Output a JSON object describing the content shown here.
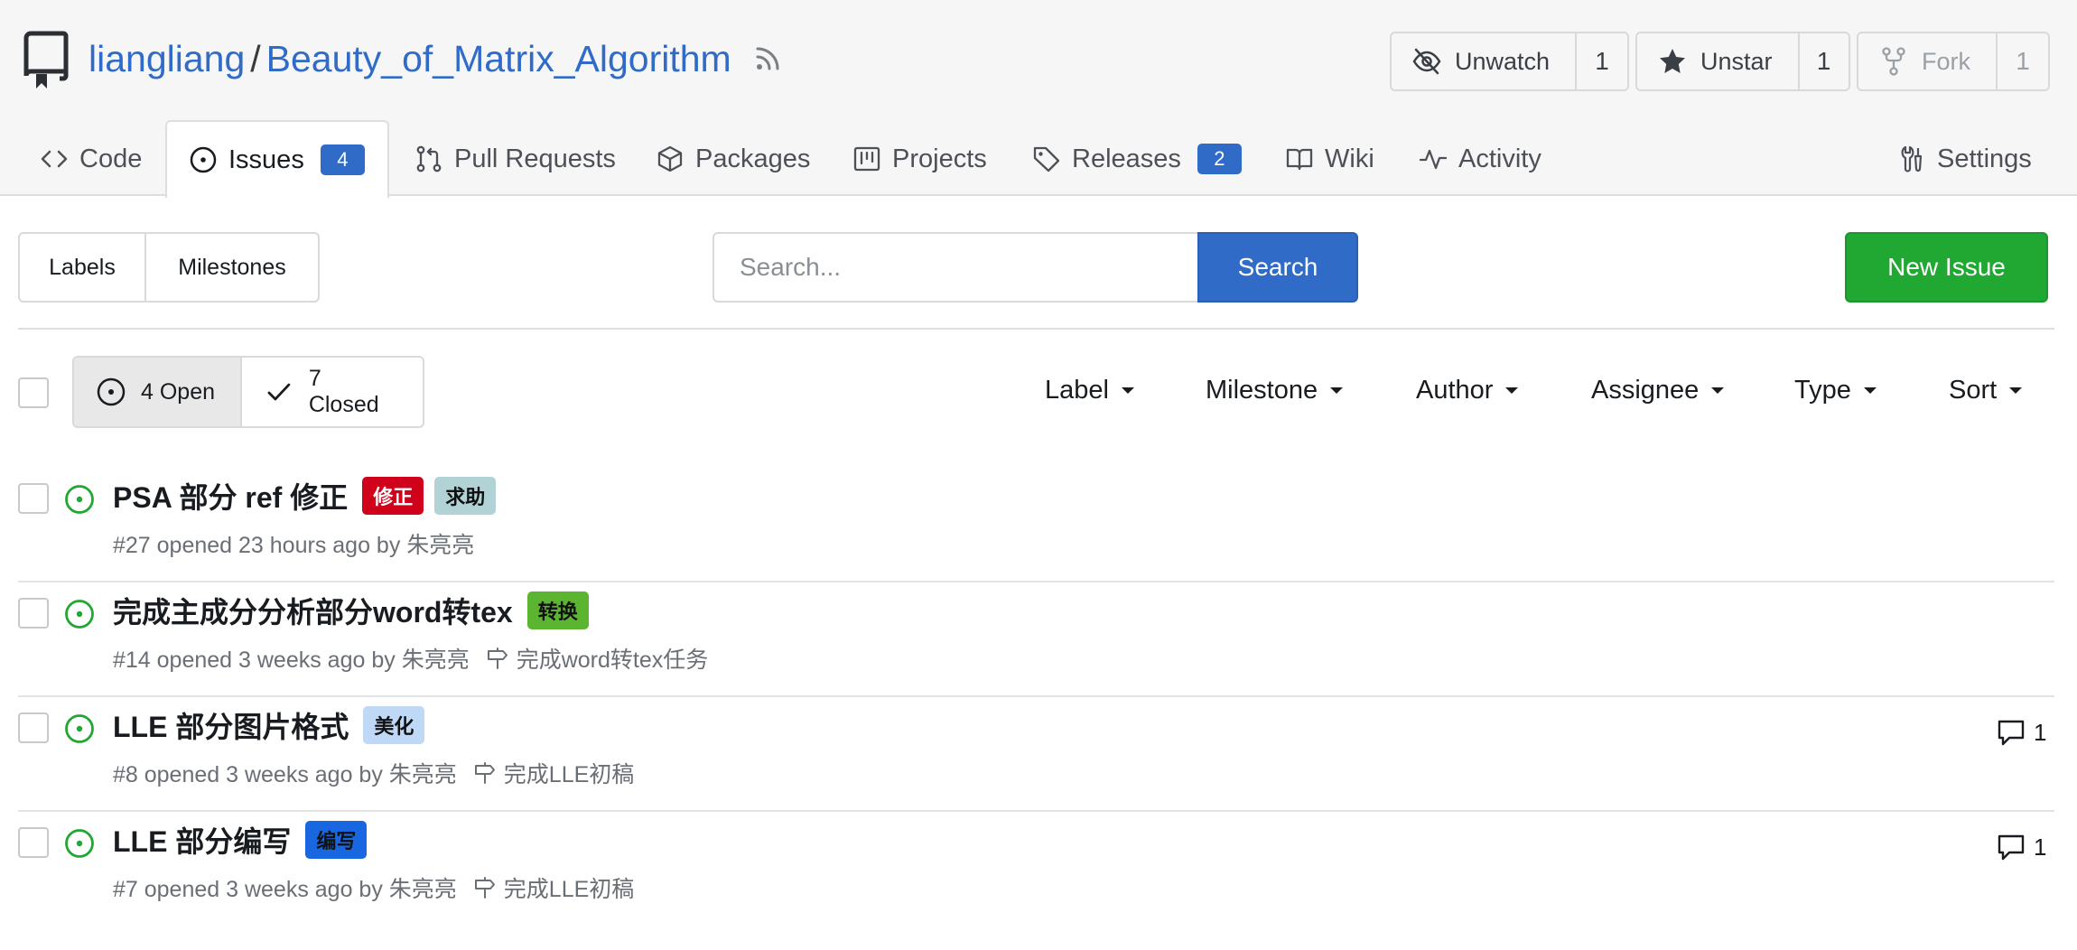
{
  "repo": {
    "owner": "liangliang",
    "separator": "/",
    "name": "Beauty_of_Matrix_Algorithm"
  },
  "actions": {
    "watch": {
      "label": "Unwatch",
      "count": "1"
    },
    "star": {
      "label": "Unstar",
      "count": "1"
    },
    "fork": {
      "label": "Fork",
      "count": "1"
    }
  },
  "tabs": {
    "code": "Code",
    "issues": {
      "label": "Issues",
      "count": "4"
    },
    "pulls": "Pull Requests",
    "packages": "Packages",
    "projects": "Projects",
    "releases": {
      "label": "Releases",
      "count": "2"
    },
    "wiki": "Wiki",
    "activity": "Activity",
    "settings": "Settings"
  },
  "toolbar": {
    "labels": "Labels",
    "milestones": "Milestones",
    "search_placeholder": "Search...",
    "search_button": "Search",
    "new_issue": "New Issue"
  },
  "state_filter": {
    "open": "4 Open",
    "closed": "7 Closed"
  },
  "filters": {
    "label": "Label",
    "milestone": "Milestone",
    "author": "Author",
    "assignee": "Assignee",
    "type": "Type",
    "sort": "Sort"
  },
  "colors": {
    "link": "#2f6bc7",
    "primary": "#2f6bc7",
    "success": "#21a833",
    "open_state": "#21a833"
  },
  "issues": [
    {
      "title": "PSA 部分 ref 修正",
      "labels": [
        {
          "text": "修正",
          "bg": "#d0021b",
          "fg": "#ffffff"
        },
        {
          "text": "求助",
          "bg": "#b2d3d6",
          "fg": "#111111"
        }
      ],
      "meta": "#27 opened 23 hours ago by 朱亮亮",
      "milestone": "",
      "comments": ""
    },
    {
      "title": "完成主成分分析部分word转tex",
      "labels": [
        {
          "text": "转换",
          "bg": "#5cb531",
          "fg": "#111111"
        }
      ],
      "meta": "#14 opened 3 weeks ago by 朱亮亮",
      "milestone": "完成word转tex任务",
      "comments": ""
    },
    {
      "title": "LLE 部分图片格式",
      "labels": [
        {
          "text": "美化",
          "bg": "#bfd8f5",
          "fg": "#111111"
        }
      ],
      "meta": "#8 opened 3 weeks ago by 朱亮亮",
      "milestone": "完成LLE初稿",
      "comments": "1"
    },
    {
      "title": "LLE 部分编写",
      "labels": [
        {
          "text": "编写",
          "bg": "#1967e0",
          "fg": "#111111"
        }
      ],
      "meta": "#7 opened 3 weeks ago by 朱亮亮",
      "milestone": "完成LLE初稿",
      "comments": "1"
    }
  ]
}
